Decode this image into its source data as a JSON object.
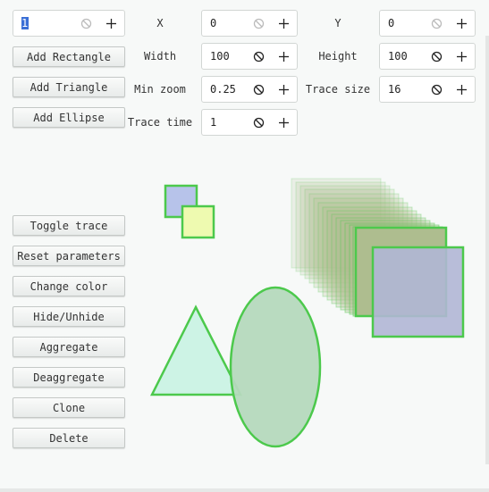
{
  "controls": {
    "name_field": {
      "value": "1"
    },
    "x": {
      "label": "X",
      "value": "0"
    },
    "y": {
      "label": "Y",
      "value": "0"
    },
    "width": {
      "label": "Width",
      "value": "100"
    },
    "height": {
      "label": "Height",
      "value": "100"
    },
    "min_zoom": {
      "label": "Min zoom",
      "value": "0.25"
    },
    "trace_size": {
      "label": "Trace size",
      "value": "16"
    },
    "trace_time": {
      "label": "Trace time",
      "value": "1"
    }
  },
  "buttons": {
    "add_rectangle": "Add Rectangle",
    "add_triangle": "Add Triangle",
    "add_ellipse": "Add Ellipse",
    "toggle_trace": "Toggle trace",
    "reset_parameters": "Reset parameters",
    "change_color": "Change color",
    "hide_unhide": "Hide/Unhide",
    "aggregate": "Aggregate",
    "deaggregate": "Deaggregate",
    "clone": "Clone",
    "delete": "Delete"
  },
  "icons": {
    "clear": "clear-icon",
    "increment": "plus-icon"
  },
  "colors": {
    "outline_green": "#4cc94c",
    "blue_fill": "#b7c3ea",
    "yellow_fill": "#eefab0",
    "mint_fill": "#cdf3e5",
    "ellipse_fill": "#b5d9bd",
    "olive_fill": "#aebd8f",
    "lavender_fill": "#b0b6d5"
  }
}
